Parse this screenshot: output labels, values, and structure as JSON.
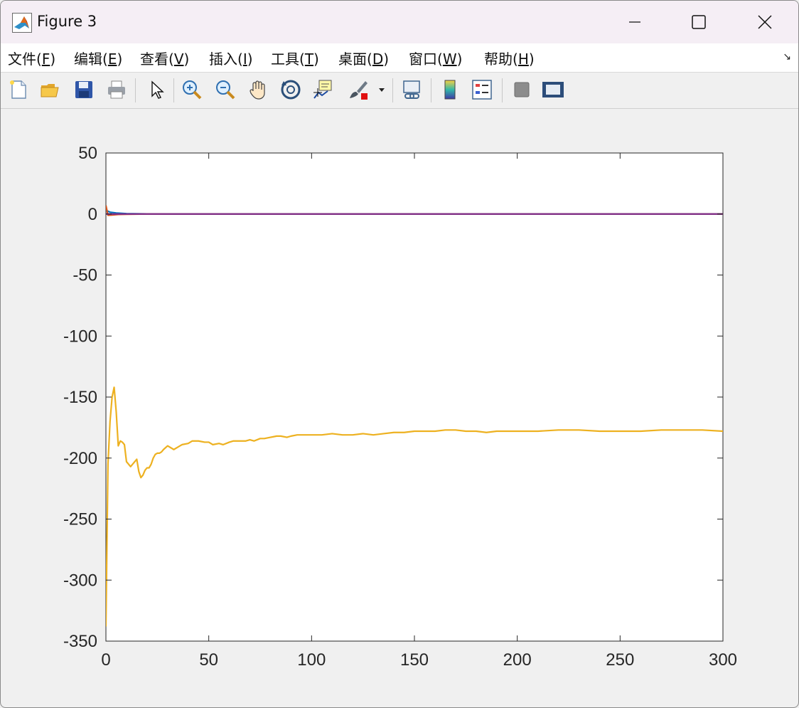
{
  "window": {
    "title": "Figure 3",
    "controls": {
      "minimize": "—",
      "maximize": "□",
      "close": "✕"
    }
  },
  "menu": {
    "items": [
      {
        "prefix": "文件(",
        "key": "F",
        "suffix": ")"
      },
      {
        "prefix": "编辑(",
        "key": "E",
        "suffix": ")"
      },
      {
        "prefix": "查看(",
        "key": "V",
        "suffix": ")"
      },
      {
        "prefix": "插入(",
        "key": "I",
        "suffix": ")"
      },
      {
        "prefix": "工具(",
        "key": "T",
        "suffix": ")"
      },
      {
        "prefix": "桌面(",
        "key": "D",
        "suffix": ")"
      },
      {
        "prefix": "窗口(",
        "key": "W",
        "suffix": ")"
      },
      {
        "prefix": "帮助(",
        "key": "H",
        "suffix": ")"
      }
    ],
    "dock_arrow": "↘"
  },
  "toolbar": {
    "buttons": [
      "new-figure-icon",
      "open-file-icon",
      "save-icon",
      "print-icon",
      "edit-plot-pointer-icon",
      "zoom-in-icon",
      "zoom-out-icon",
      "pan-hand-icon",
      "rotate-3d-icon",
      "data-cursor-icon",
      "brush-icon",
      "link-plot-icon",
      "colorbar-icon",
      "legend-icon",
      "hide-plot-tools-icon",
      "show-plot-tools-icon"
    ]
  },
  "chart_data": {
    "type": "line",
    "title": "",
    "xlabel": "",
    "ylabel": "",
    "xlim": [
      0,
      300
    ],
    "ylim": [
      -350,
      50
    ],
    "xticks": [
      0,
      50,
      100,
      150,
      200,
      250,
      300
    ],
    "yticks": [
      50,
      0,
      -50,
      -100,
      -150,
      -200,
      -250,
      -300,
      -350
    ],
    "xtick_labels": [
      "0",
      "50",
      "100",
      "150",
      "200",
      "250",
      "300"
    ],
    "ytick_labels": [
      "50",
      "0",
      "-50",
      "-100",
      "-150",
      "-200",
      "-250",
      "-300",
      "-350"
    ],
    "grid": false,
    "series": [
      {
        "color": "#0072bd",
        "x": [
          0,
          2,
          5,
          10,
          20,
          40,
          300
        ],
        "y": [
          3,
          1.5,
          0.8,
          0.3,
          0.1,
          0,
          0
        ]
      },
      {
        "color": "#d95319",
        "x": [
          0,
          1,
          3,
          6,
          10,
          20,
          300
        ],
        "y": [
          7,
          -1,
          -0.8,
          -0.4,
          -0.2,
          0,
          0
        ]
      },
      {
        "color": "#7e2f8e",
        "x": [
          0,
          300
        ],
        "y": [
          0,
          0
        ]
      },
      {
        "color": "#edb120",
        "x": [
          0,
          1,
          2,
          3,
          4,
          5,
          6,
          7,
          8,
          9,
          10,
          11,
          12,
          13,
          14,
          15,
          16,
          17,
          18,
          19,
          20,
          21,
          22,
          23,
          24,
          25,
          26,
          27,
          28,
          30,
          33,
          35,
          37,
          40,
          42,
          45,
          48,
          50,
          52,
          55,
          57,
          60,
          62,
          65,
          68,
          70,
          72,
          75,
          77,
          80,
          83,
          85,
          88,
          90,
          93,
          95,
          100,
          105,
          110,
          115,
          120,
          125,
          130,
          135,
          140,
          145,
          150,
          155,
          160,
          165,
          170,
          175,
          180,
          185,
          190,
          195,
          200,
          210,
          220,
          225,
          230,
          240,
          250,
          260,
          270,
          280,
          290,
          300
        ],
        "y": [
          -338,
          -205,
          -170,
          -150,
          -142,
          -162,
          -190,
          -186,
          -187,
          -189,
          -203,
          -205,
          -207,
          -205,
          -203,
          -201,
          -211,
          -216,
          -214,
          -210,
          -208,
          -208,
          -205,
          -200,
          -197,
          -196,
          -196,
          -195,
          -193,
          -190,
          -193,
          -191,
          -189,
          -188,
          -186,
          -186,
          -187,
          -187,
          -189,
          -188,
          -189,
          -187,
          -186,
          -186,
          -186,
          -185,
          -186,
          -184,
          -184,
          -183,
          -182,
          -182,
          -183,
          -182,
          -181,
          -181,
          -181,
          -181,
          -180,
          -181,
          -181,
          -180,
          -181,
          -180,
          -179,
          -179,
          -178,
          -178,
          -178,
          -177,
          -177,
          -178,
          -178,
          -179,
          -178,
          -178,
          -178,
          -178,
          -177,
          -177,
          -177,
          -178,
          -178,
          -178,
          -177,
          -177,
          -177,
          -178
        ]
      }
    ]
  }
}
